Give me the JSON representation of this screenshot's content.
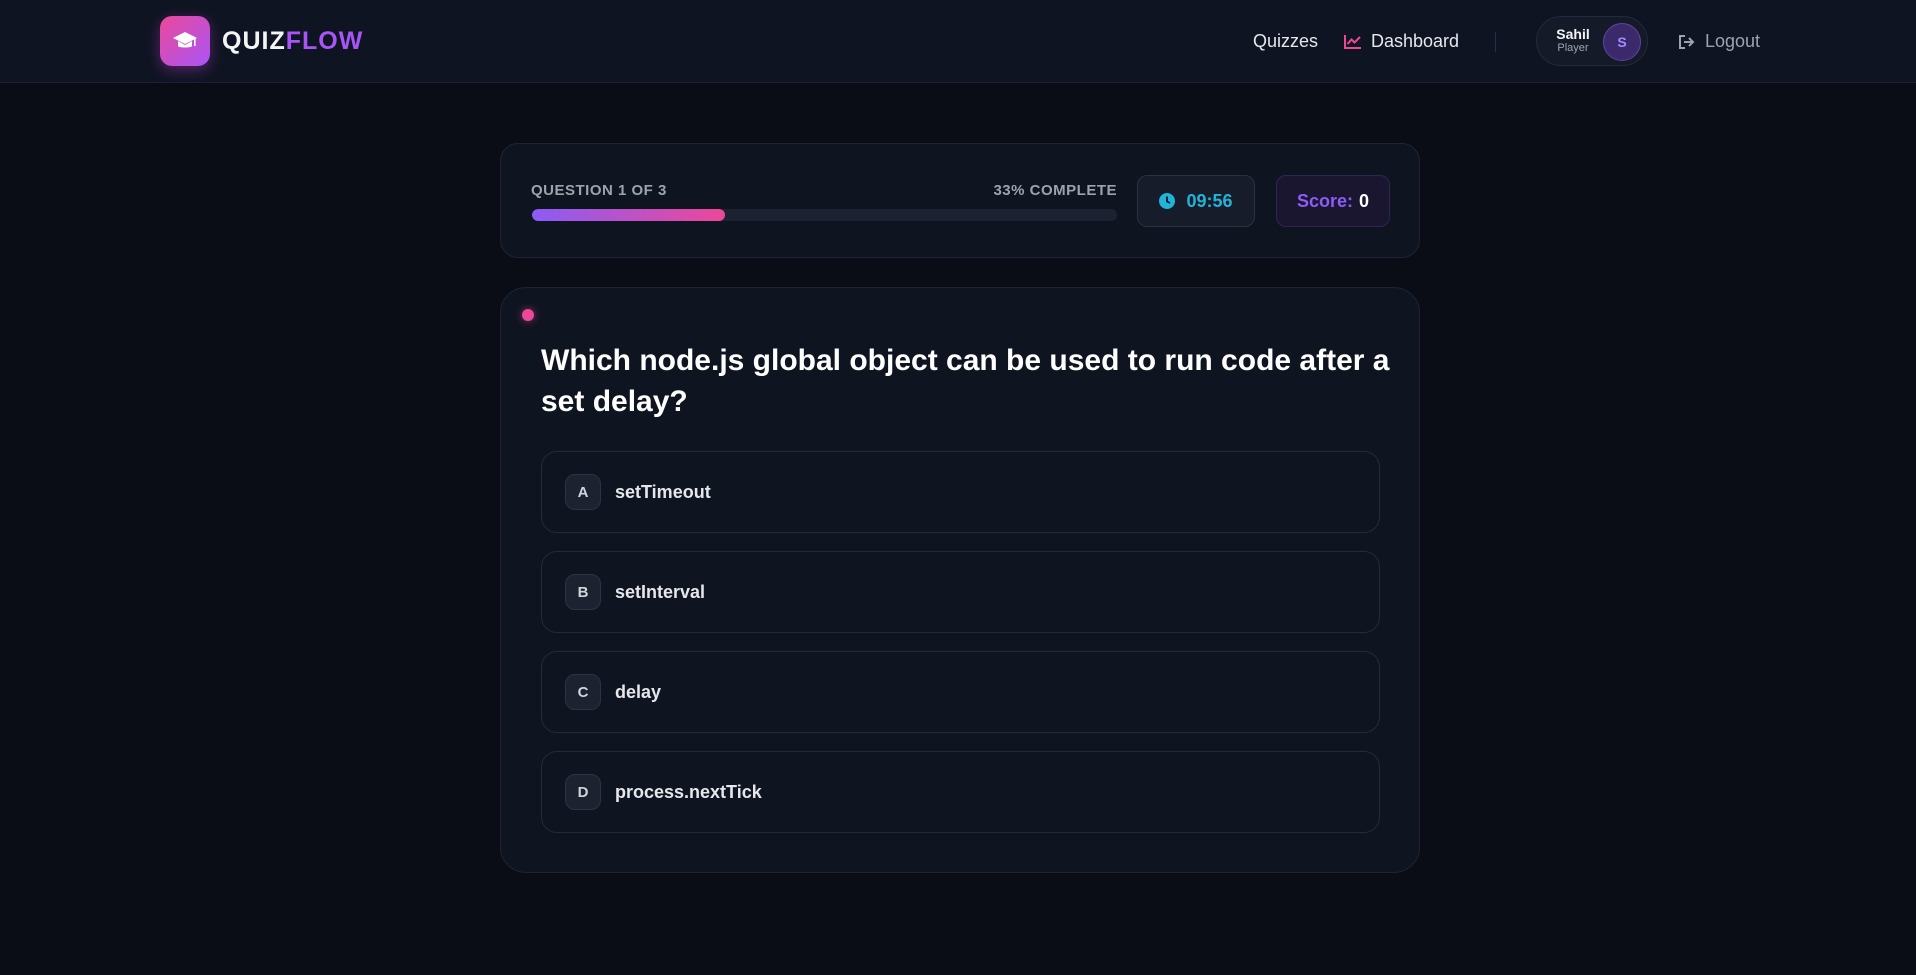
{
  "brand": {
    "part1": "QUIZ",
    "part2": "FLOW",
    "logo_icon": "graduation-cap-icon"
  },
  "nav": {
    "quizzes": "Quizzes",
    "dashboard": "Dashboard",
    "dashboard_icon": "line-chart-icon",
    "logout": "Logout",
    "logout_icon": "sign-out-icon"
  },
  "user": {
    "name": "Sahil",
    "role": "Player",
    "initial": "S"
  },
  "progress": {
    "counter": "QUESTION 1 OF 3",
    "complete": "33% COMPLETE",
    "percent": 33,
    "timer": "09:56",
    "score_label": "Score:",
    "score_value": "0"
  },
  "question": {
    "text": "Which node.js global object can be used to run code after a set delay?",
    "options": [
      {
        "letter": "A",
        "label": "setTimeout"
      },
      {
        "letter": "B",
        "label": "setInterval"
      },
      {
        "letter": "C",
        "label": "delay"
      },
      {
        "letter": "D",
        "label": "process.nextTick"
      }
    ]
  },
  "colors": {
    "accent_purple": "#a855f7",
    "accent_pink": "#ec4899",
    "timer_cyan": "#22b3d8",
    "background": "#0a0d15"
  }
}
